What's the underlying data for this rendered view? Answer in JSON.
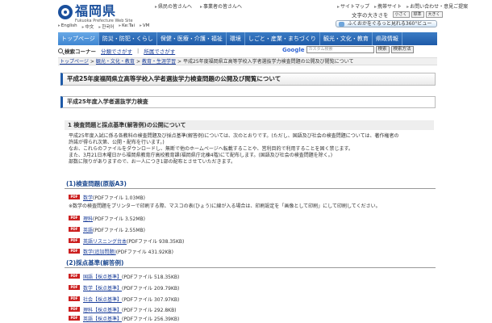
{
  "header": {
    "logo_main": "福岡県",
    "logo_sub": "Fukuoka Prefecture Web Site",
    "top_links": [
      "県民の皆さんへ",
      "事業者の皆さんへ"
    ],
    "right_links": [
      "サイトマップ",
      "携帯サイト",
      "お問い合わせ・意見ご提案"
    ],
    "font_size_label": "文字の大きさを",
    "font_size_options": [
      "小さく",
      "標準",
      "大きく"
    ],
    "banner_text": "ふくおかをぐるっと見れる360°ビュー",
    "lang_links": [
      "English",
      "中文",
      "한국어",
      "Ke:Tai",
      "VM"
    ]
  },
  "nav": {
    "items": [
      "トップページ",
      "防災・防犯・くらし",
      "保健・医療・介護・福祉",
      "環境",
      "しごと・産業・まちづくり",
      "観光・文化・教育",
      "県政情報"
    ],
    "active_index": 0
  },
  "search": {
    "label": "検索コーナー",
    "link1": "分類でさがす",
    "link2": "所属でさがす",
    "google_label": "Google",
    "placeholder": "カスタム検索",
    "button1": "検索",
    "button2": "検索方法"
  },
  "breadcrumb": [
    "トップページ",
    "観光・文化・教育",
    "教育・生涯学習",
    "平成25年度福岡県立高等学校入学者選抜学力検査問題の公開及び閲覧について"
  ],
  "content": {
    "page_title": "平成25年度福岡県立高等学校入学者選抜学力検査問題の公開及び閲覧について",
    "section_title": "平成25年度入学者選抜学力検査",
    "subheading": "1 検査問題と採点基準(解答例)の公開について",
    "paragraphs": [
      "平成25年度入試に係る各教科の検査問題及び採点基準(解答例)については、次のとおりです。(ただし、国語及び社会の検査問題については、著作権者の",
      "許諾が得られ次第、公開・配布を行います。)",
      "なお、これらのファイルをダウンロードし、無断で他のホームページへ転載することや、営利目的で利用することを固く禁じます。",
      "また、3月21日木曜日から福岡県教育庁高校教育課(福岡県庁北棟4階)にて配布します。(国語及び社会の検査問題を除く。)",
      "部数に限りがありますので、お一人につき1部の配布とさせていただきます。"
    ],
    "h3_problems": "(1)検査問題(原版A3)",
    "note": "※数学の検査問題をプリンターで印刷する際、マスコの表(ひょう)に線が入る場合は、印刷設定を「画像として印刷」にして印刷してください。",
    "problems": [
      {
        "name": "数学",
        "size": "(PDFファイル 1.03MB)"
      },
      {
        "name": "理科",
        "size": "(PDFファイル 3.52MB)"
      },
      {
        "name": "英語",
        "size": "(PDFファイル 2.55MB)"
      },
      {
        "name": "英語リスニング台本",
        "size": "(PDFファイル 938.35KB)"
      },
      {
        "name": "数学(追加問題)",
        "size": "(PDFファイル 431.92KB)"
      }
    ],
    "h3_answers": "(2)採点基準(解答例)",
    "answers": [
      {
        "name": "国語【採点基準】",
        "size": "(PDFファイル 518.35KB)"
      },
      {
        "name": "数学【採点基準】",
        "size": "(PDFファイル 209.79KB)"
      },
      {
        "name": "社会【採点基準】",
        "size": "(PDFファイル 307.97KB)"
      },
      {
        "name": "理科【採点基準】",
        "size": "(PDFファイル 292.8KB)"
      },
      {
        "name": "英語【採点基準】",
        "size": "(PDFファイル 256.39KB)"
      }
    ],
    "pdf_badge": "PDF"
  }
}
